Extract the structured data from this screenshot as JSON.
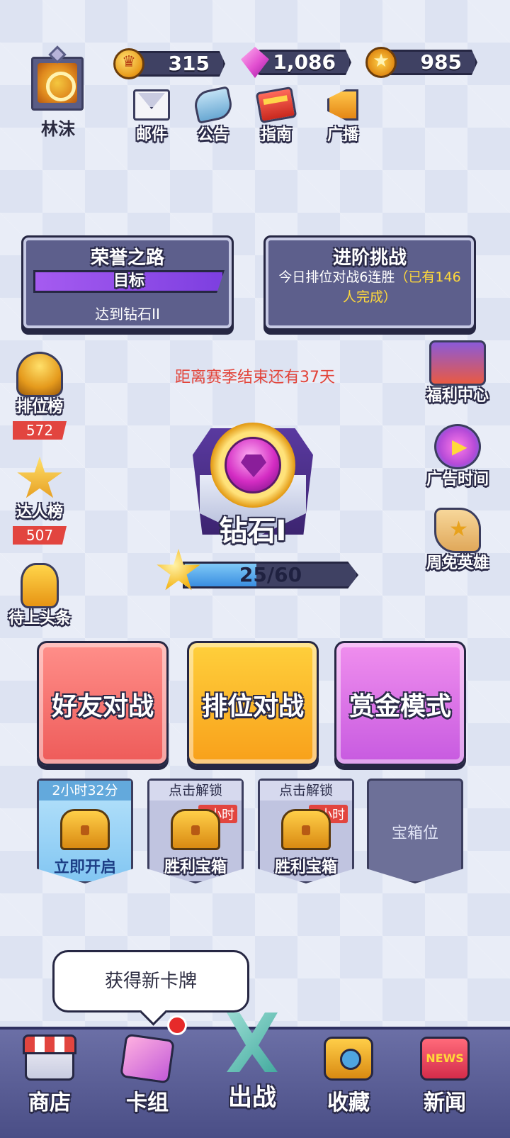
{
  "player": {
    "name": "林沫"
  },
  "currencies": {
    "coins": "315",
    "gems": "1,086",
    "stars": "985"
  },
  "top_menu": {
    "mail": "邮件",
    "notice": "公告",
    "guide": "指南",
    "broadcast": "广播"
  },
  "honor_road": {
    "title": "荣誉之路",
    "goal_label": "目标",
    "goal_desc": "达到钻石II"
  },
  "advance_challenge": {
    "title": "进阶挑战",
    "desc": "今日排位对战6连胜",
    "highlight": "（已有146人完成）"
  },
  "season": {
    "text": "距离赛季结束还有37天"
  },
  "left_side": {
    "rank_board": {
      "label": "排位榜",
      "value": "572"
    },
    "master_board": {
      "label": "达人榜",
      "value": "507"
    },
    "headline": {
      "label": "待上头条"
    }
  },
  "right_side": {
    "welfare": "福利中心",
    "ad_time": "广告时间",
    "free_heroes": "周免英雄"
  },
  "rank": {
    "name": "钻石I",
    "progress_text": "25/60",
    "progress": 0.4167
  },
  "modes": {
    "friend": "好友对战",
    "ranked": "排位对战",
    "bounty": "赏金模式"
  },
  "chests": [
    {
      "top": "2小时32分",
      "bottom": "立即开启"
    },
    {
      "top": "点击解锁",
      "tag": "3小时",
      "bottom": "胜利宝箱"
    },
    {
      "top": "点击解锁",
      "tag": "3小时",
      "bottom": "胜利宝箱"
    },
    {
      "empty": "宝箱位"
    }
  ],
  "tooltip": {
    "text": "获得新卡牌"
  },
  "bottom_nav": {
    "shop": "商店",
    "deck": "卡组",
    "battle": "出战",
    "collect": "收藏",
    "news": "新闻",
    "news_icon_text": "NEWS"
  },
  "colors": {
    "accent_red": "#e2453f",
    "highlight_yellow": "#ffd93a",
    "panel": "#5d5f8c"
  }
}
